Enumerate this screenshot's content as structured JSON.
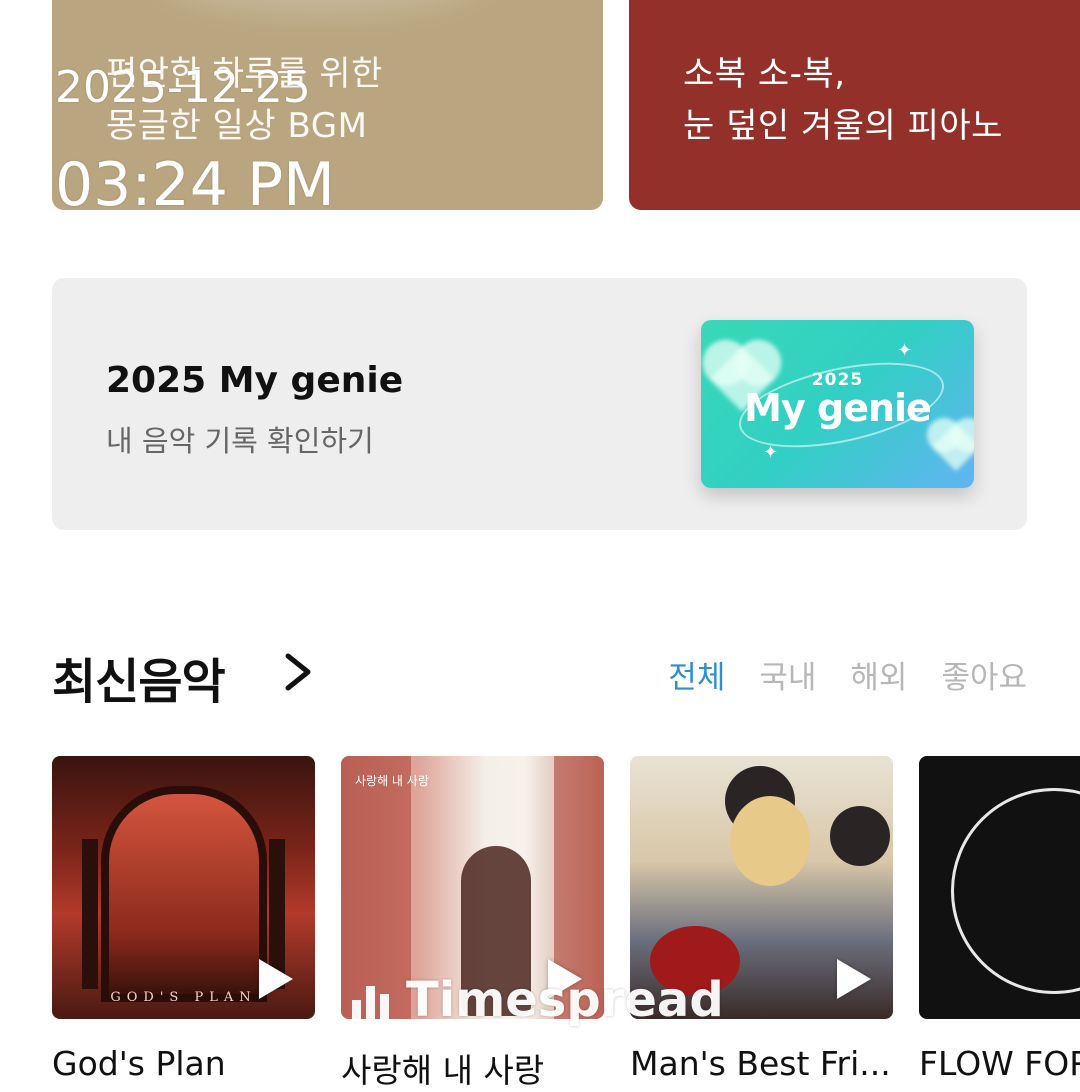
{
  "overlay": {
    "date": "2025-12-25",
    "time": "03:24 PM"
  },
  "playlist_cards": [
    {
      "line1": "편안한 하루를 위한",
      "line2": "몽글한 일상 BGM",
      "color": "#b9a57f"
    },
    {
      "line1": "소복 소-복,",
      "line2": "눈 덮인 겨울의 피아노",
      "color": "#94302a"
    }
  ],
  "banner": {
    "title": "2025 My genie",
    "subtitle": "내 음악 기록 확인하기",
    "art_year": "2025",
    "art_name": "My genie"
  },
  "section": {
    "title": "최신음악",
    "chevron_icon": "chevron-right-icon",
    "tabs": [
      {
        "label": "전체",
        "active": true
      },
      {
        "label": "국내",
        "active": false
      },
      {
        "label": "해외",
        "active": false
      },
      {
        "label": "좋아요",
        "active": false
      }
    ],
    "accent_color": "#2f8fd1"
  },
  "albums": [
    {
      "title": "God's Plan",
      "cover_caption": "GOD'S PLAN"
    },
    {
      "title": "사랑해 내 사랑",
      "cover_caption": "사랑해 내 사랑"
    },
    {
      "title": "Man's Best Fri..."
    },
    {
      "title": "FLOW FOR"
    }
  ],
  "watermark": "Timespread"
}
